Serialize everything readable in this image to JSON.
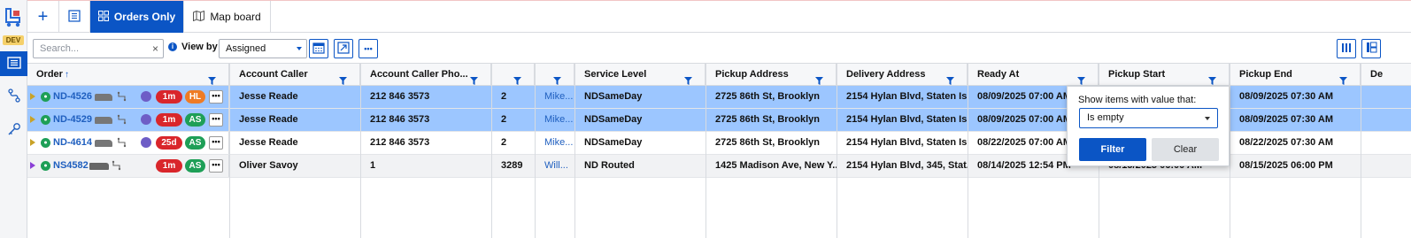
{
  "rail": {
    "badge": "DEV",
    "items": [
      "logo-icon",
      "list-icon",
      "route-icon",
      "key-icon"
    ]
  },
  "topbar": {
    "add_label": "+",
    "tabs": [
      {
        "label": "Orders Only",
        "active": true
      },
      {
        "label": "Map board",
        "active": false
      }
    ]
  },
  "toolbar": {
    "search_placeholder": "Search...",
    "clear_label": "×",
    "info_label": "i",
    "viewby_label": "View by",
    "viewby_value": "Assigned",
    "more_label": "•••"
  },
  "table": {
    "columns": [
      {
        "label": "Order"
      },
      {
        "label": "Account Caller"
      },
      {
        "label": "Account Caller Pho..."
      },
      {
        "label": ""
      },
      {
        "label": ""
      },
      {
        "label": "Service Level"
      },
      {
        "label": "Pickup Address"
      },
      {
        "label": "Delivery Address"
      },
      {
        "label": "Ready At"
      },
      {
        "label": "Pickup Start"
      },
      {
        "label": "Pickup End"
      },
      {
        "label": "De"
      }
    ],
    "rows": [
      {
        "order": "ND-4526",
        "timer": "1m",
        "tag": "HL",
        "tag_color": "orange",
        "selected": true,
        "marker_color": "#c9a227",
        "caller": "Jesse Reade",
        "phone": "212 846 3573",
        "c4": "2",
        "c5": "Mike...",
        "service": "NDSameDay",
        "pickup": "2725 86th St, Brooklyn",
        "delivery": "2154 Hylan Blvd, Staten Isl...",
        "ready": "08/09/2025 07:00 AM",
        "pstart": "",
        "pend": "08/09/2025 07:30 AM"
      },
      {
        "order": "ND-4529",
        "timer": "1m",
        "tag": "AS",
        "tag_color": "green",
        "selected": true,
        "marker_color": "#c9a227",
        "caller": "Jesse Reade",
        "phone": "212 846 3573",
        "c4": "2",
        "c5": "Mike...",
        "service": "NDSameDay",
        "pickup": "2725 86th St, Brooklyn",
        "delivery": "2154 Hylan Blvd, Staten Isl...",
        "ready": "08/09/2025 07:00 AM",
        "pstart": "",
        "pend": "08/09/2025 07:30 AM"
      },
      {
        "order": "ND-4614",
        "timer": "25d",
        "tag": "AS",
        "tag_color": "green",
        "selected": false,
        "marker_color": "#c9a227",
        "caller": "Jesse Reade",
        "phone": "212 846 3573",
        "c4": "2",
        "c5": "Mike...",
        "service": "NDSameDay",
        "pickup": "2725 86th St, Brooklyn",
        "delivery": "2154 Hylan Blvd, Staten Isl...",
        "ready": "08/22/2025 07:00 AM",
        "pstart": "",
        "pend": "08/22/2025 07:30 AM"
      },
      {
        "order": "NS4582",
        "timer": "1m",
        "tag": "AS",
        "tag_color": "green",
        "selected": false,
        "marker_color": "#8b3fd6",
        "caller": "Oliver Savoy",
        "phone": "1",
        "c4": "3289",
        "c5": "Will...",
        "service": "ND Routed",
        "pickup": "1425 Madison Ave, New Y...",
        "delivery": "2154 Hylan Blvd, 345, Stat...",
        "ready": "08/14/2025 12:54 PM",
        "pstart": "08/15/2025 06:00 AM",
        "pend": "08/15/2025 06:00 PM"
      }
    ]
  },
  "filter_popup": {
    "title": "Show items with value that:",
    "condition": "Is empty",
    "filter_label": "Filter",
    "clear_label": "Clear"
  },
  "colors": {
    "accent": "#0b55c5",
    "selected_row": "#9cc6ff",
    "link": "#1f5fbf"
  }
}
